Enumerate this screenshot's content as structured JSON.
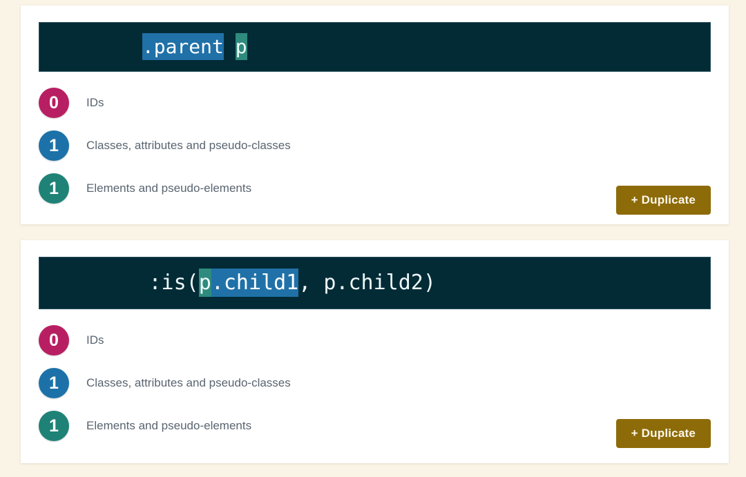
{
  "theme": {
    "page_background": "#faf4e6",
    "card_background": "#ffffff",
    "code_background": "#022b36",
    "class_highlight": "#2071a8",
    "element_highlight": "#2e8b7e",
    "badge_ids_color": "#b81f62",
    "badge_classes_color": "#1c72a8",
    "badge_elements_color": "#1f8277",
    "button_color": "#8d6b08",
    "label_color": "#596470"
  },
  "cards": [
    {
      "selector_tokens": [
        {
          "text": ".parent",
          "type": "class"
        },
        {
          "text": " ",
          "type": "plain"
        },
        {
          "text": "p",
          "type": "element"
        }
      ],
      "specificity": [
        {
          "count": "0",
          "label": "IDs",
          "kind": "ids"
        },
        {
          "count": "1",
          "label": "Classes, attributes and pseudo-classes",
          "kind": "classes"
        },
        {
          "count": "1",
          "label": "Elements and pseudo-elements",
          "kind": "elements"
        }
      ],
      "duplicate_label": "+ Duplicate"
    },
    {
      "selector_tokens": [
        {
          "text": ":is(",
          "type": "plain"
        },
        {
          "text": "p",
          "type": "element"
        },
        {
          "text": ".child1",
          "type": "class"
        },
        {
          "text": ", p.child2)",
          "type": "plain"
        }
      ],
      "specificity": [
        {
          "count": "0",
          "label": "IDs",
          "kind": "ids"
        },
        {
          "count": "1",
          "label": "Classes, attributes and pseudo-classes",
          "kind": "classes"
        },
        {
          "count": "1",
          "label": "Elements and pseudo-elements",
          "kind": "elements"
        }
      ],
      "duplicate_label": "+ Duplicate"
    }
  ]
}
